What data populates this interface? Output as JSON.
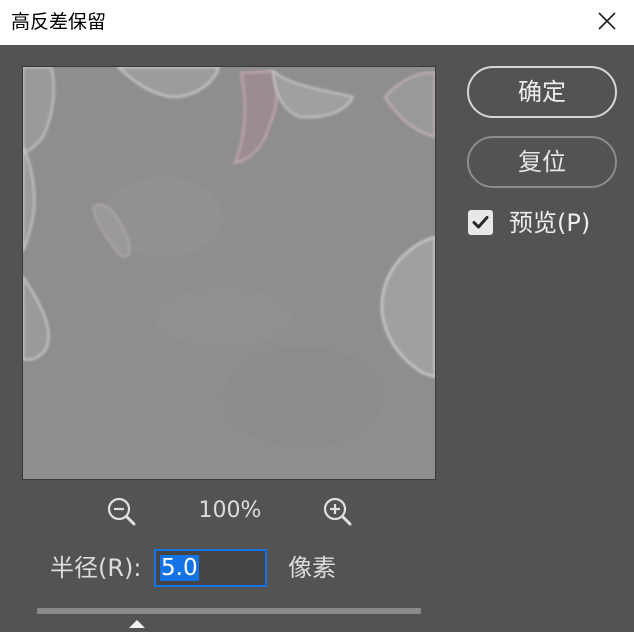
{
  "dialog": {
    "title": "高反差保留",
    "close_icon": "close-icon"
  },
  "buttons": {
    "ok_label": "确定",
    "reset_label": "复位"
  },
  "preview_option": {
    "label": "预览(P)",
    "checked": true
  },
  "zoom": {
    "value": "100%",
    "zoom_out_icon": "zoom-out-icon",
    "zoom_in_icon": "zoom-in-icon"
  },
  "radius": {
    "label": "半径(R):",
    "value": "5.0",
    "unit": "像素",
    "slider_fraction": 0.26
  },
  "colors": {
    "dialog_bg": "#535353",
    "preview_gray": "#8f8f8f",
    "focus_blue": "#1473e6",
    "titlebar_bg": "#ffffff"
  }
}
